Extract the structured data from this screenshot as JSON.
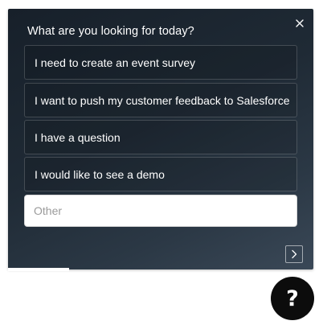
{
  "survey": {
    "question": "What are you looking for today?",
    "options": [
      "I need to create an event survey",
      "I want to push my customer feedback to Salesforce",
      "I have a question",
      "I would like to see a demo"
    ],
    "other_placeholder": "Other",
    "close_icon": "close-icon",
    "next_icon": "chevron-right-icon",
    "progress": 0.2
  },
  "help_button": {
    "label": "?",
    "icon": "question-mark-icon"
  },
  "colors": {
    "panel_background": "#1f2a35",
    "text": "#ffffff",
    "help_button_background": "#0c0c0c"
  }
}
